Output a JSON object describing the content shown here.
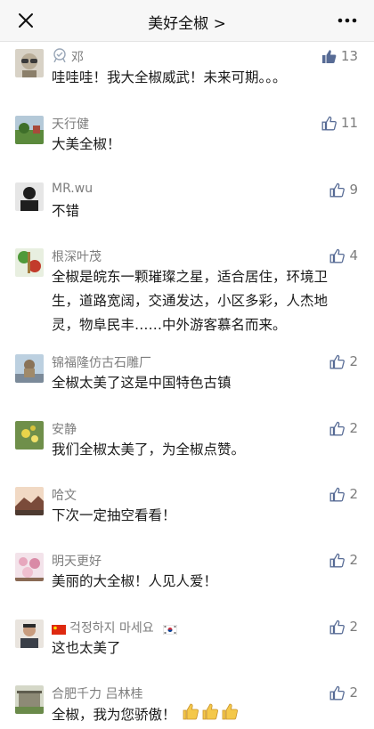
{
  "header": {
    "title": "美好全椒 >",
    "close_icon": "close-icon",
    "more_icon": "more-icon"
  },
  "comments": [
    {
      "name": "邓",
      "text": "哇哇哇！我大全椒威武！未来可期。。。",
      "likes": "13",
      "liked": true
    },
    {
      "name": "天行健",
      "text": "大美全椒！",
      "likes": "11",
      "liked": false
    },
    {
      "name": "MR.wu",
      "text": "不错",
      "likes": "9",
      "liked": false
    },
    {
      "name": "根深叶茂",
      "text_lines": [
        "全椒是皖东一颗璀璨之星，适合居住，环境卫",
        "生，道路宽阔，交通发达，小区多彩，人杰地",
        "灵，物阜民丰……中外游客慕名而来。"
      ],
      "likes": "4",
      "liked": false
    },
    {
      "name": "锦福隆仿古石雕厂",
      "text": "全椒太美了这是中国特色古镇",
      "likes": "2",
      "liked": false
    },
    {
      "name": "安静",
      "text": "我们全椒太美了，为全椒点赞。",
      "likes": "2",
      "liked": false
    },
    {
      "name": "哈文",
      "text": "下次一定抽空看看！",
      "likes": "2",
      "liked": false
    },
    {
      "name": "明天更好",
      "text": "美丽的大全椒！人见人爱！",
      "likes": "2",
      "liked": false
    },
    {
      "name": "걱정하지 마세요",
      "text": "这也太美了",
      "likes": "2",
      "liked": false
    },
    {
      "name": "合肥千力 吕林桂",
      "text": "全椒，我为您骄傲！",
      "likes": "2",
      "liked": false
    }
  ],
  "colors": {
    "accent": "#576b95",
    "name": "#7d7d7d",
    "text": "#1a1a1a"
  }
}
